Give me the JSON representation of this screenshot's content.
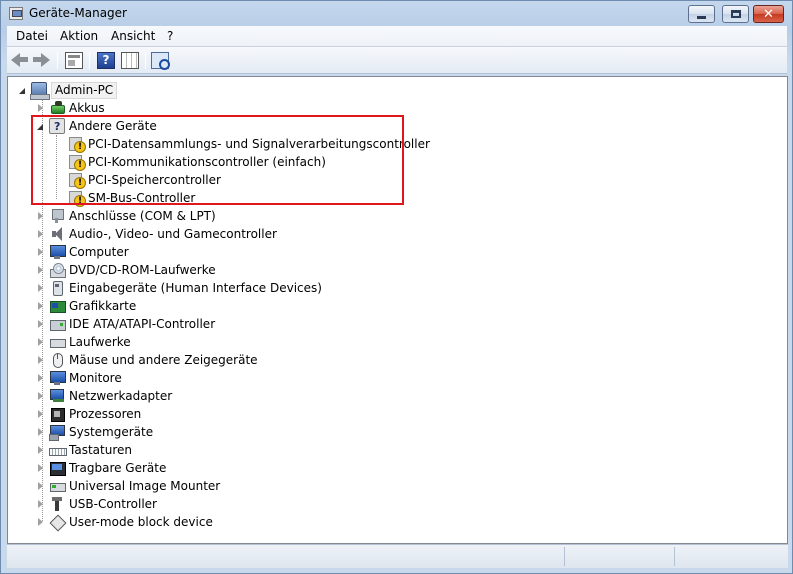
{
  "window": {
    "title": "Geräte-Manager",
    "accent_color": "#c4d7ed",
    "controls": {
      "minimize": "–",
      "maximize": "□",
      "close": "✕"
    }
  },
  "menu": {
    "items": [
      "Datei",
      "Aktion",
      "Ansicht",
      "?"
    ]
  },
  "toolbar": {
    "buttons": [
      {
        "name": "back",
        "icon": "back-arrow-icon"
      },
      {
        "name": "forward",
        "icon": "forward-arrow-icon"
      },
      {
        "name": "properties",
        "icon": "properties-icon"
      },
      {
        "name": "help",
        "icon": "help-icon",
        "glyph": "?"
      },
      {
        "name": "view",
        "icon": "view-grid-icon"
      },
      {
        "name": "scan",
        "icon": "scan-hardware-icon"
      }
    ]
  },
  "tree": {
    "root": {
      "label": "Admin-PC",
      "icon": "computer-icon",
      "expanded": true
    },
    "categories": [
      {
        "label": "Akkus",
        "icon": "battery-icon",
        "expanded": false
      },
      {
        "label": "Andere Geräte",
        "icon": "unknown-device-icon",
        "expanded": true,
        "children": [
          {
            "label": "PCI-Datensammlungs- und Signalverarbeitungscontroller",
            "icon": "warning-device-icon"
          },
          {
            "label": "PCI-Kommunikationscontroller (einfach)",
            "icon": "warning-device-icon"
          },
          {
            "label": "PCI-Speichercontroller",
            "icon": "warning-device-icon"
          },
          {
            "label": "SM-Bus-Controller",
            "icon": "warning-device-icon"
          }
        ]
      },
      {
        "label": "Anschlüsse (COM & LPT)",
        "icon": "port-icon",
        "expanded": false
      },
      {
        "label": "Audio-, Video- und Gamecontroller",
        "icon": "speaker-icon",
        "expanded": false
      },
      {
        "label": "Computer",
        "icon": "monitor-icon",
        "expanded": false
      },
      {
        "label": "DVD/CD-ROM-Laufwerke",
        "icon": "disc-drive-icon",
        "expanded": false
      },
      {
        "label": "Eingabegeräte (Human Interface Devices)",
        "icon": "hid-icon",
        "expanded": false
      },
      {
        "label": "Grafikkarte",
        "icon": "graphics-card-icon",
        "expanded": false
      },
      {
        "label": "IDE ATA/ATAPI-Controller",
        "icon": "ide-controller-icon",
        "expanded": false
      },
      {
        "label": "Laufwerke",
        "icon": "drive-icon",
        "expanded": false
      },
      {
        "label": "Mäuse und andere Zeigegeräte",
        "icon": "mouse-icon",
        "expanded": false
      },
      {
        "label": "Monitore",
        "icon": "monitor-icon",
        "expanded": false
      },
      {
        "label": "Netzwerkadapter",
        "icon": "network-adapter-icon",
        "expanded": false
      },
      {
        "label": "Prozessoren",
        "icon": "processor-icon",
        "expanded": false
      },
      {
        "label": "Systemgeräte",
        "icon": "system-device-icon",
        "expanded": false
      },
      {
        "label": "Tastaturen",
        "icon": "keyboard-icon",
        "expanded": false
      },
      {
        "label": "Tragbare Geräte",
        "icon": "portable-device-icon",
        "expanded": false
      },
      {
        "label": "Universal Image Mounter",
        "icon": "image-mounter-icon",
        "expanded": false
      },
      {
        "label": "USB-Controller",
        "icon": "usb-icon",
        "expanded": false
      },
      {
        "label": "User-mode block device",
        "icon": "block-device-icon",
        "expanded": false
      }
    ]
  },
  "annotation": {
    "highlight_color": "#e0161d",
    "highlighted_group": "Andere Geräte"
  },
  "statusbar": {
    "text": ""
  }
}
